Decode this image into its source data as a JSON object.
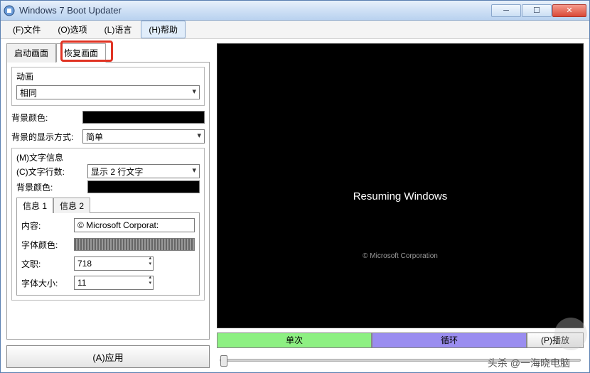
{
  "titlebar": {
    "title": "Windows 7 Boot Updater"
  },
  "menu": {
    "file": "(F)文件",
    "options": "(O)选项",
    "language": "(L)语言",
    "help": "(H)帮助"
  },
  "left": {
    "tabs": {
      "boot": "启动画面",
      "resume": "恢复画面"
    },
    "animation": {
      "group_title": "动画",
      "value": "相同"
    },
    "bgcolor_label": "背景颜色:",
    "bgcolor_value": "#000000",
    "bgmode_label": "背景的显示方式:",
    "bgmode_value": "简单",
    "text_group": {
      "title": "(M)文字信息",
      "lines_label": "(C)文字行数:",
      "lines_value": "显示 2 行文字",
      "bgcolor_label": "背景颜色:",
      "bgcolor_value": "#000000",
      "subtabs": {
        "info1": "信息 1",
        "info2": "信息 2"
      },
      "content_label": "内容:",
      "content_value": "© Microsoft Corporat:",
      "fontcolor_label": "字体颜色:",
      "pos_label": "文职:",
      "pos_value": "718",
      "fontsize_label": "字体大小:",
      "fontsize_value": "11"
    },
    "apply": "(A)应用"
  },
  "preview": {
    "main_text": "Resuming Windows",
    "copyright": "© Microsoft Corporation"
  },
  "controls": {
    "once": "单次",
    "loop": "循环",
    "play": "(P)播放"
  },
  "footer": "头杀 @一海晓电脑"
}
